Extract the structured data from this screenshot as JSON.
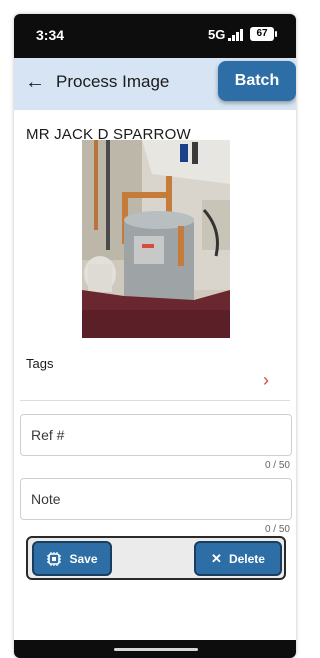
{
  "status_bar": {
    "time": "3:34",
    "network": "5G",
    "battery": "67"
  },
  "app_bar": {
    "title": "Process Image",
    "back_icon": "arrow-left-icon",
    "batch_label": "Batch"
  },
  "customer": {
    "name": "MR JACK D SPARROW"
  },
  "tags": {
    "label": "Tags",
    "chevron_icon": "chevron-right-icon"
  },
  "ref_field": {
    "placeholder": "Ref #",
    "value": "",
    "counter": "0 / 50"
  },
  "note_field": {
    "placeholder": "Note",
    "value": "",
    "counter": "0 / 50"
  },
  "actions": {
    "save_label": "Save",
    "save_icon": "save-chip-icon",
    "delete_label": "Delete",
    "delete_icon": "close-icon"
  },
  "colors": {
    "accent": "#2e6ea6",
    "app_bar_bg": "#d6e4f3",
    "chevron": "#d9483b"
  }
}
